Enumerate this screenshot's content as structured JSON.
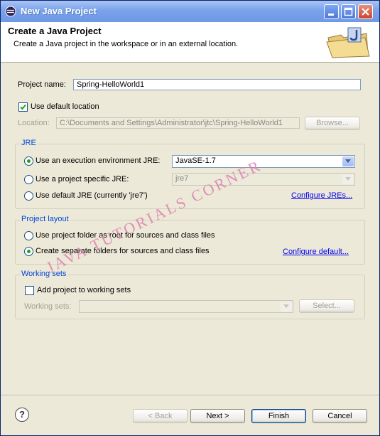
{
  "window": {
    "title": "New Java Project"
  },
  "header": {
    "title": "Create a Java Project",
    "description": "Create a Java project in the workspace or in an external location."
  },
  "project": {
    "name_label": "Project name:",
    "name_value": "Spring-HelloWorld1"
  },
  "location": {
    "use_default_label": "Use default location",
    "use_default_checked": true,
    "label": "Location:",
    "value": "C:\\Documents and Settings\\Administrator\\jtc\\Spring-HelloWorld1",
    "browse_label": "Browse..."
  },
  "jre": {
    "group_title": "JRE",
    "exec_env_label": "Use an execution environment JRE:",
    "exec_env_value": "JavaSE-1.7",
    "project_specific_label": "Use a project specific JRE:",
    "project_specific_value": "jre7",
    "default_label": "Use default JRE (currently 'jre7')",
    "configure_link": "Configure JREs..."
  },
  "layout": {
    "group_title": "Project layout",
    "root_label": "Use project folder as root for sources and class files",
    "separate_label": "Create separate folders for sources and class files",
    "configure_link": "Configure default..."
  },
  "working_sets": {
    "group_title": "Working sets",
    "add_label": "Add project to working sets",
    "sets_label": "Working sets:",
    "select_label": "Select..."
  },
  "watermark": "JAVA TUTORIALS CORNER",
  "footer": {
    "help": "?",
    "back_label": "< Back",
    "next_label": "Next >",
    "finish_label": "Finish",
    "cancel_label": "Cancel"
  }
}
